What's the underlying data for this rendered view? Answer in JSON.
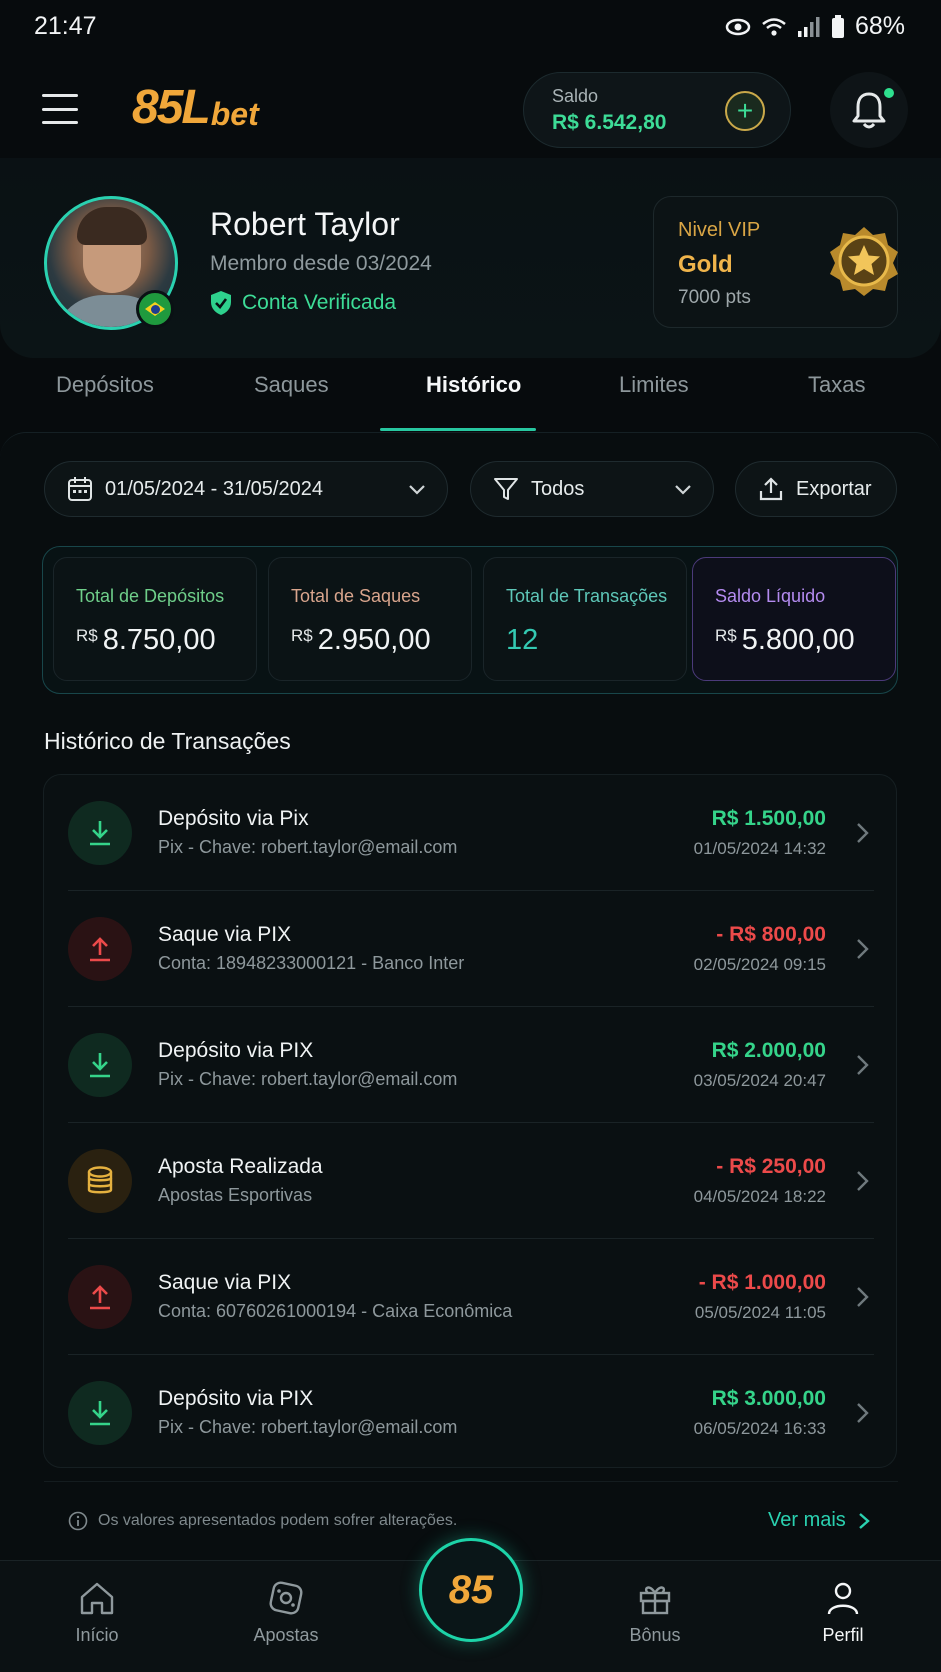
{
  "status_bar": {
    "time": "21:47",
    "battery": "68%"
  },
  "header": {
    "logo_main": "85L",
    "logo_sub": "bet",
    "balance_label": "Saldo",
    "balance_value": "R$ 6.542,80",
    "add_symbol": "+"
  },
  "profile": {
    "name": "Robert Taylor",
    "member_since": "Membro desde 03/2024",
    "verified_label": "Conta Verificada",
    "vip_label": "Nivel VIP",
    "vip_level": "Gold",
    "vip_points": "7000 pts"
  },
  "tabs": [
    {
      "label": "Depósitos"
    },
    {
      "label": "Saques"
    },
    {
      "label": "Histórico"
    },
    {
      "label": "Limites"
    },
    {
      "label": "Taxas"
    }
  ],
  "active_tab": "Histórico",
  "filters": {
    "date_range": "01/05/2024 - 31/05/2024",
    "type": "Todos",
    "export_label": "Exportar"
  },
  "summary": {
    "currency": "R$",
    "deposits_label": "Total de Depósitos",
    "deposits_value": "8.750,00",
    "withdrawals_label": "Total de Saques",
    "withdrawals_value": "2.950,00",
    "transactions_label": "Total de Transações",
    "transactions_value": "12",
    "net_label": "Saldo Líquido",
    "net_value": "5.800,00"
  },
  "transactions_title": "Histórico de Transações",
  "transactions": [
    {
      "kind": "in",
      "title": "Depósito via Pix",
      "subtitle": "Pix - Chave: robert.taylor@email.com",
      "amount": "R$ 1.500,00",
      "date": "01/05/2024 14:32"
    },
    {
      "kind": "out",
      "title": "Saque via PIX",
      "subtitle": "Conta: 18948233000121 - Banco Inter",
      "amount": "- R$ 800,00",
      "date": "02/05/2024 09:15"
    },
    {
      "kind": "in",
      "title": "Depósito via PIX",
      "subtitle": "Pix - Chave: robert.taylor@email.com",
      "amount": "R$ 2.000,00",
      "date": "03/05/2024 20:47"
    },
    {
      "kind": "bet",
      "title": "Aposta Realizada",
      "subtitle": "Apostas Esportivas",
      "amount": "- R$ 250,00",
      "date": "04/05/2024 18:22"
    },
    {
      "kind": "out",
      "title": "Saque via PIX",
      "subtitle": "Conta: 60760261000194 - Caixa Econômica",
      "amount": "- R$ 1.000,00",
      "date": "05/05/2024 11:05"
    },
    {
      "kind": "in",
      "title": "Depósito via PIX",
      "subtitle": "Pix - Chave: robert.taylor@email.com",
      "amount": "R$ 3.000,00",
      "date": "06/05/2024 16:33"
    }
  ],
  "footer": {
    "note": "Os valores apresentados podem sofrer alterações.",
    "see_more": "Ver mais"
  },
  "bottom_nav": {
    "items": [
      {
        "label": "Início",
        "icon": "home-icon"
      },
      {
        "label": "Apostas",
        "icon": "dice-icon"
      },
      {
        "label": "Bônus",
        "icon": "gift-icon"
      },
      {
        "label": "Perfil",
        "icon": "user-icon"
      }
    ],
    "center_label": "85",
    "active": "Perfil"
  },
  "colors": {
    "accent": "#2ad1b0",
    "positive": "#35d48a",
    "negative": "#ec4a4a",
    "gold": "#f0a73a",
    "background": "#070b0d"
  }
}
